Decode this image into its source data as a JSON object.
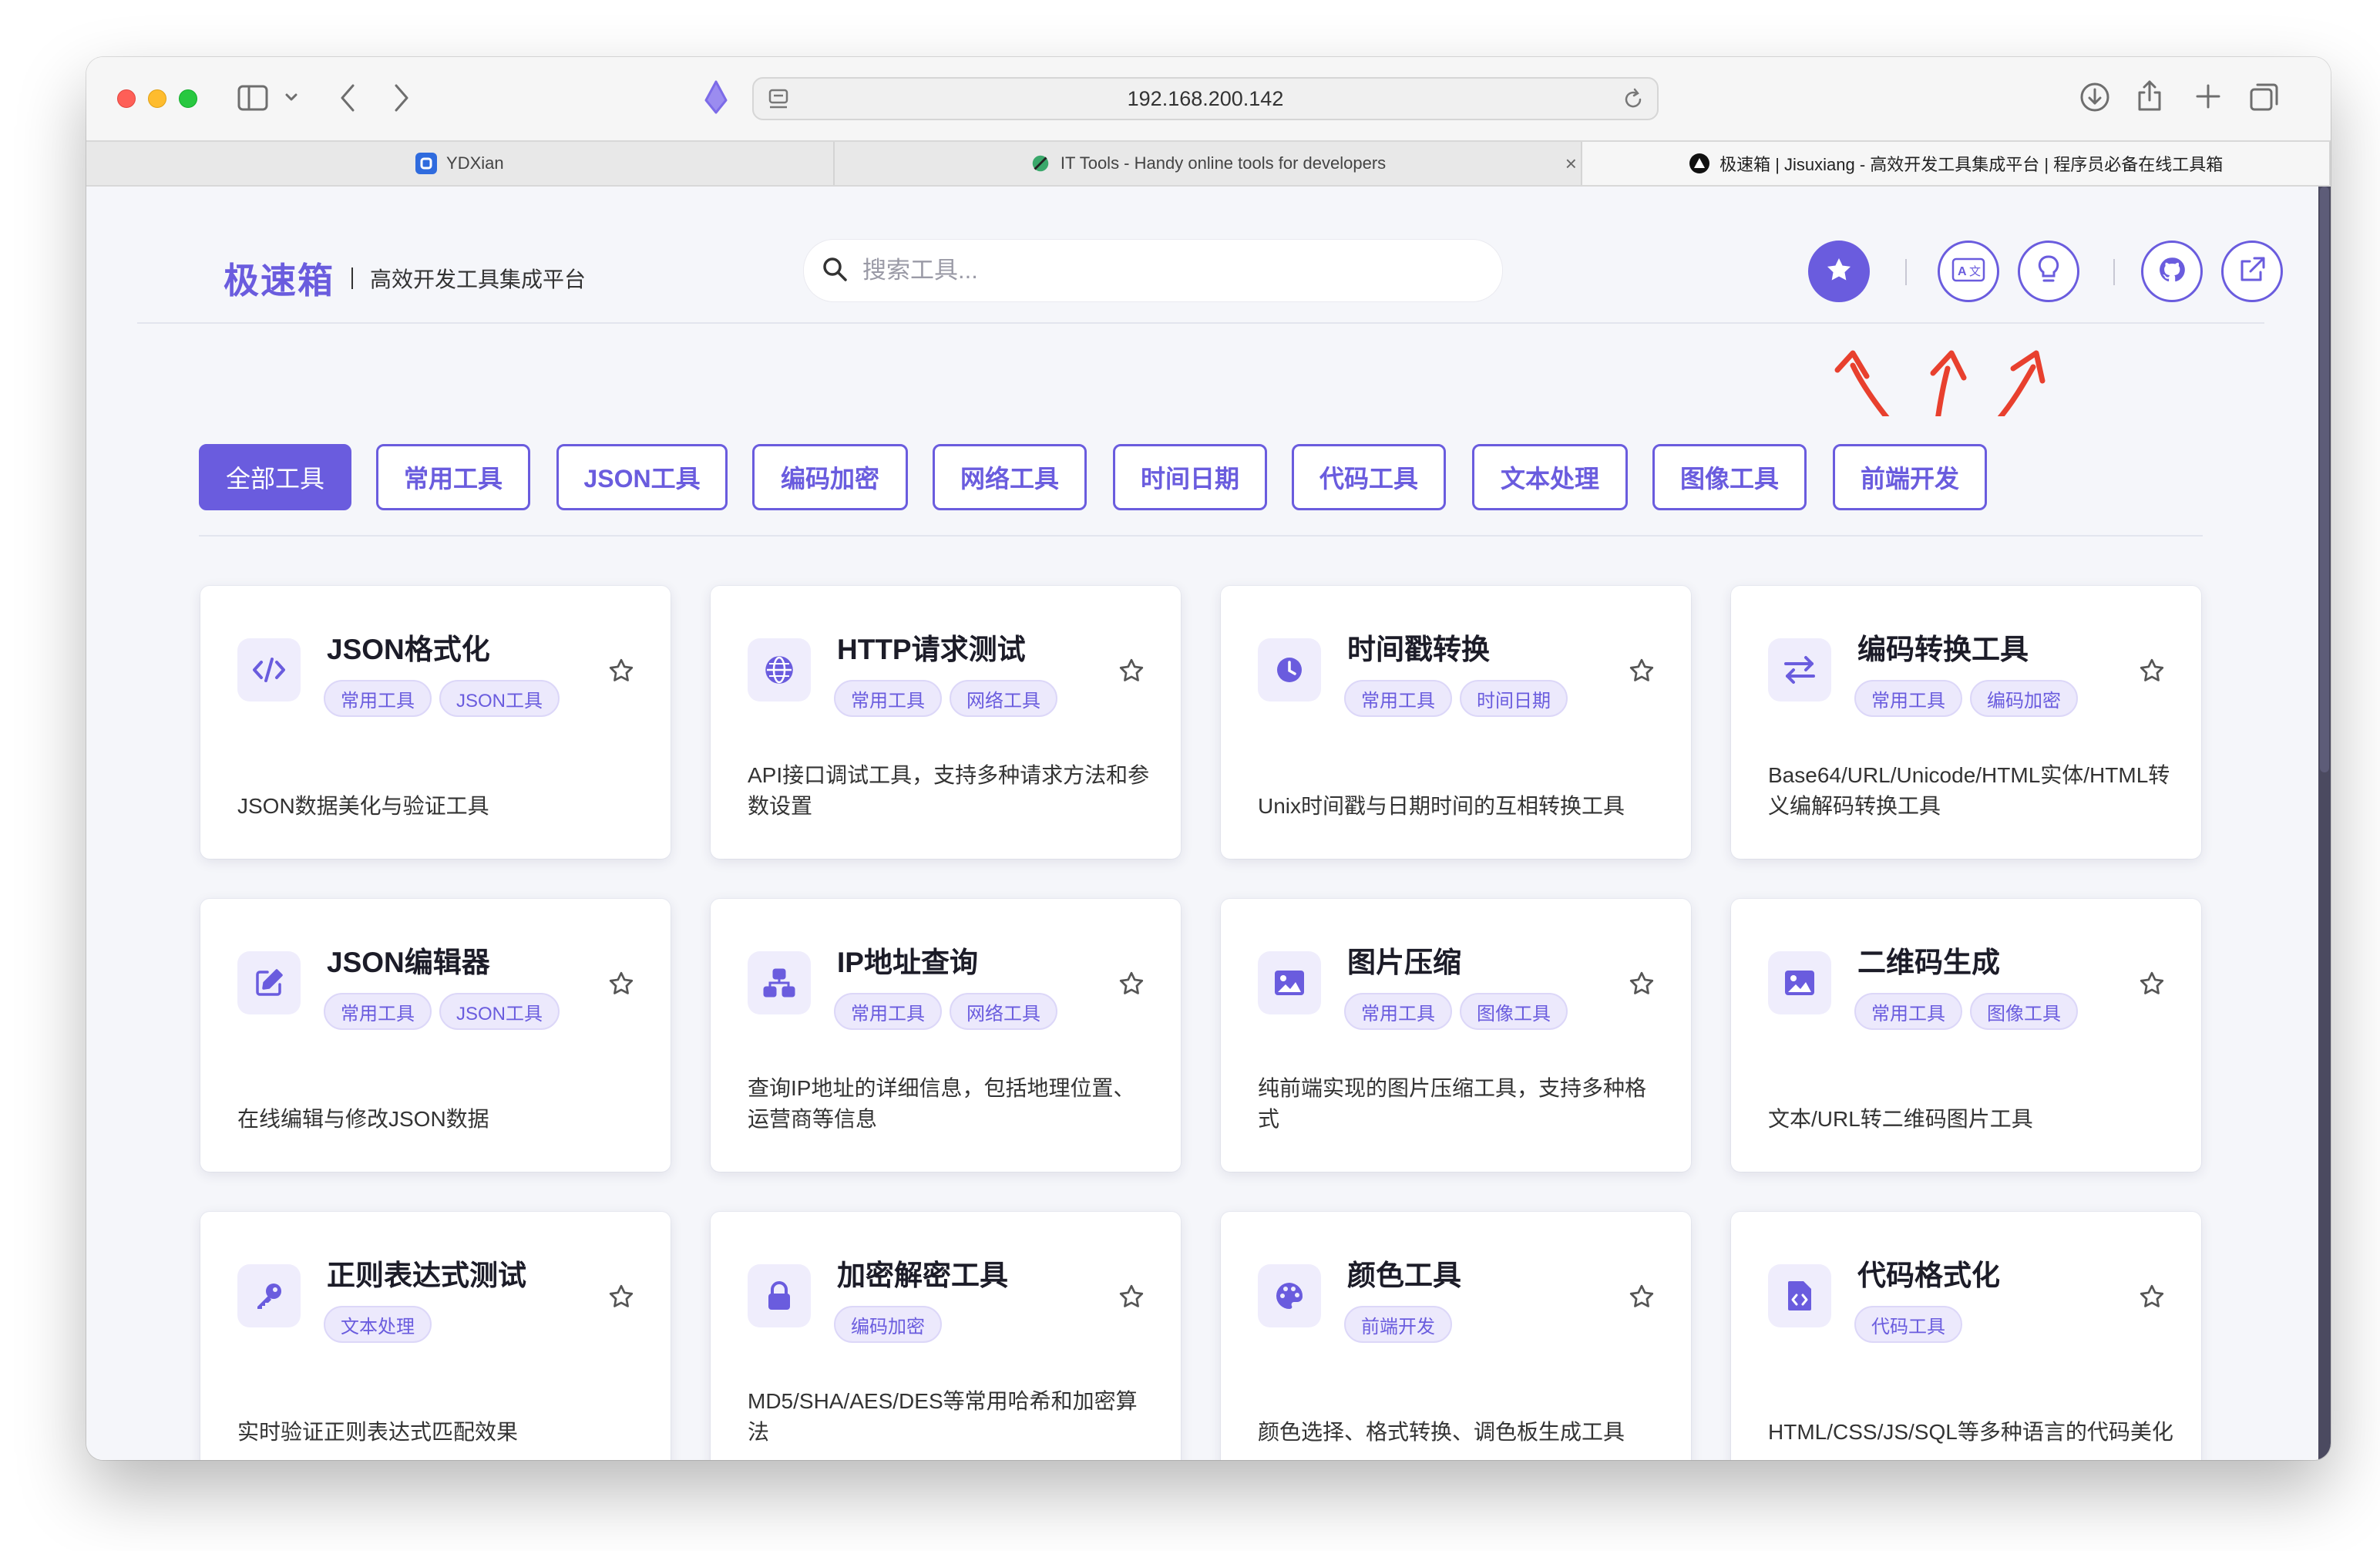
{
  "browser": {
    "url": "192.168.200.142",
    "tabs": [
      {
        "title": "YDXian",
        "active": false
      },
      {
        "title": "IT Tools - Handy online tools for developers",
        "active": false
      },
      {
        "title": "极速箱 | Jisuxiang - 高效开发工具集成平台 | 程序员必备在线工具箱",
        "active": true
      }
    ]
  },
  "header": {
    "brand_name": "极速箱",
    "brand_subtitle": "高效开发工具集成平台",
    "search_placeholder": "搜索工具...",
    "action_icons": [
      "star-icon",
      "translate-icon",
      "lightbulb-icon",
      "github-icon",
      "external-link-icon"
    ],
    "accent_color": "#6a5cde"
  },
  "categories": [
    "全部工具",
    "常用工具",
    "JSON工具",
    "编码加密",
    "网络工具",
    "时间日期",
    "代码工具",
    "文本处理",
    "图像工具",
    "前端开发"
  ],
  "active_category": "全部工具",
  "tools": [
    {
      "title": "JSON格式化",
      "tags": [
        "常用工具",
        "JSON工具"
      ],
      "desc": "JSON数据美化与验证工具",
      "icon": "code-icon"
    },
    {
      "title": "HTTP请求测试",
      "tags": [
        "常用工具",
        "网络工具"
      ],
      "desc": "API接口调试工具，支持多种请求方法和参数设置",
      "icon": "globe-icon"
    },
    {
      "title": "时间戳转换",
      "tags": [
        "常用工具",
        "时间日期"
      ],
      "desc": "Unix时间戳与日期时间的互相转换工具",
      "icon": "clock-icon"
    },
    {
      "title": "编码转换工具",
      "tags": [
        "常用工具",
        "编码加密"
      ],
      "desc": "Base64/URL/Unicode/HTML实体/HTML转义编解码转换工具",
      "icon": "exchange-icon"
    },
    {
      "title": "JSON编辑器",
      "tags": [
        "常用工具",
        "JSON工具"
      ],
      "desc": "在线编辑与修改JSON数据",
      "icon": "edit-icon"
    },
    {
      "title": "IP地址查询",
      "tags": [
        "常用工具",
        "网络工具"
      ],
      "desc": "查询IP地址的详细信息，包括地理位置、运营商等信息",
      "icon": "network-icon"
    },
    {
      "title": "图片压缩",
      "tags": [
        "常用工具",
        "图像工具"
      ],
      "desc": "纯前端实现的图片压缩工具，支持多种格式",
      "icon": "image-icon"
    },
    {
      "title": "二维码生成",
      "tags": [
        "常用工具",
        "图像工具"
      ],
      "desc": "文本/URL转二维码图片工具",
      "icon": "image-icon"
    },
    {
      "title": "正则表达式测试",
      "tags": [
        "文本处理"
      ],
      "desc": "实时验证正则表达式匹配效果",
      "icon": "key-icon"
    },
    {
      "title": "加密解密工具",
      "tags": [
        "编码加密"
      ],
      "desc": "MD5/SHA/AES/DES等常用哈希和加密算法",
      "icon": "lock-icon"
    },
    {
      "title": "颜色工具",
      "tags": [
        "前端开发"
      ],
      "desc": "颜色选择、格式转换、调色板生成工具",
      "icon": "palette-icon"
    },
    {
      "title": "代码格式化",
      "tags": [
        "代码工具"
      ],
      "desc": "HTML/CSS/JS/SQL等多种语言的代码美化",
      "icon": "file-code-icon"
    }
  ]
}
